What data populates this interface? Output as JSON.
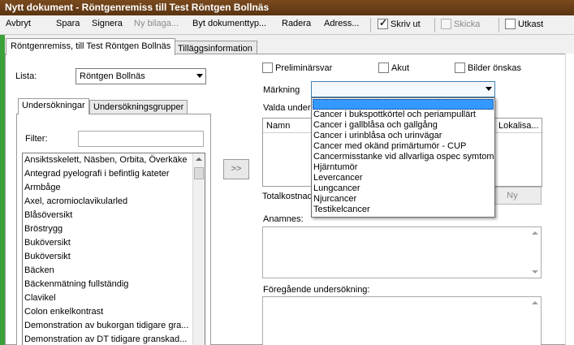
{
  "window": {
    "title": "Nytt dokument - Röntgenremiss till Test Röntgen Bollnäs"
  },
  "toolbar": {
    "cancel": "Avbryt",
    "save": "Spara",
    "sign": "Signera",
    "new_attachment": "Ny bilaga...",
    "change_doc_type": "Byt dokumenttyp...",
    "delete": "Radera",
    "address": "Adress...",
    "print_label": "Skriv ut",
    "print_checked": true,
    "send_label": "Skicka",
    "draft_label": "Utkast"
  },
  "tabs": [
    {
      "label": "Röntgenremiss, till Test Röntgen Bollnäs",
      "active": true
    },
    {
      "label": "Tilläggsinformation",
      "active": false
    }
  ],
  "left": {
    "list_label": "Lista:",
    "list_value": "Röntgen Bollnäs",
    "subtabs": [
      "Undersökningar",
      "Undersökningsgrupper"
    ],
    "filter_label": "Filter:",
    "filter_value": "",
    "exams": [
      "Ansiktsskelett, Näsben, Orbita, Överkäke",
      "Antegrad pyelografi i befintlig kateter",
      "Armbåge",
      "Axel, acromioclavikularled",
      "Blåsöversikt",
      "Bröstrygg",
      "Buköversikt",
      "Buköversikt",
      "Bäcken",
      "Bäckenmätning fullständig",
      "Clavikel",
      "Colon enkelkontrast",
      "Demonstration av bukorgan tidigare gra...",
      "Demonstration av DT tidigare granskad..."
    ],
    "add_button": ">>"
  },
  "right": {
    "preliminary_label": "Preliminärsvar",
    "acute_label": "Akut",
    "images_label": "Bilder önskas",
    "marking_label": "Märkning",
    "selected_label": "Valda unders",
    "col_name": "Namn",
    "col_location": "Lokalisa...",
    "total_cost_label": "Totalkostnad",
    "new_button": "Ny",
    "anamnesis_label": "Anamnes:",
    "previous_exam_label": "Föregående undersökning:"
  },
  "marking_dropdown": {
    "selected_value": "",
    "options": [
      "Cancer i bukspottkörtel och periampullärt",
      "Cancer i gallblåsa och gallgång",
      "Cancer i urinblåsa och urinvägar",
      "Cancer med okänd primärtumör - CUP",
      "Cancermisstanke vid allvarliga ospec symtom",
      "Hjärntumör",
      "Levercancer",
      "Lungcancer",
      "Njurcancer",
      "Testikelcancer"
    ]
  }
}
